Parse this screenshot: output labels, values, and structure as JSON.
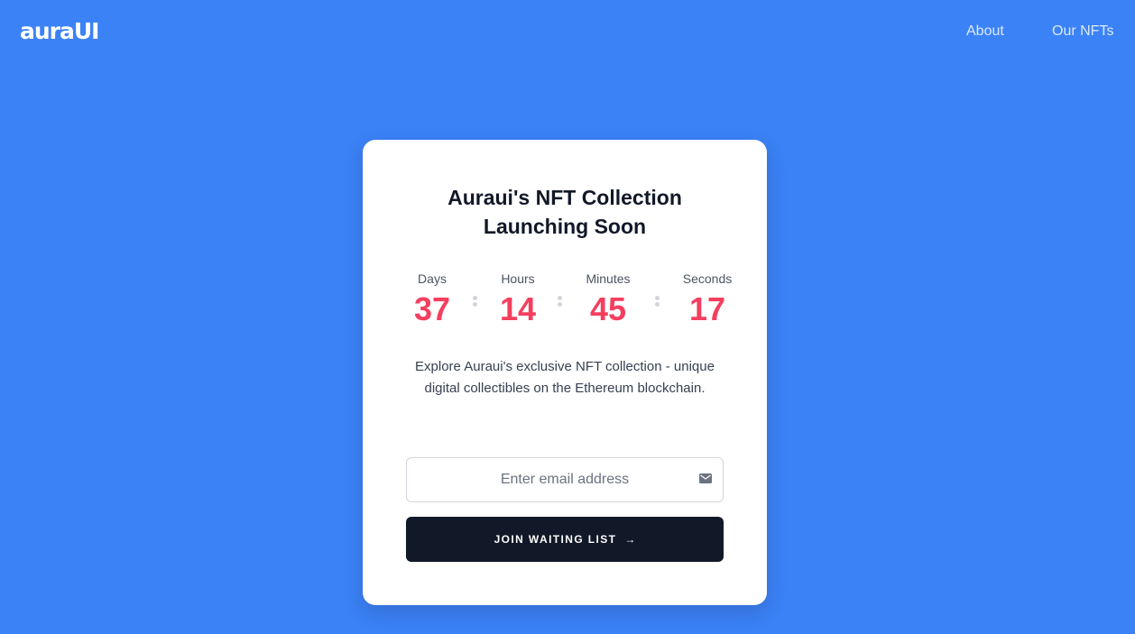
{
  "header": {
    "logo": "auraUI",
    "nav": [
      {
        "label": "About"
      },
      {
        "label": "Our NFTs"
      }
    ]
  },
  "card": {
    "title_line1": "Auraui's NFT Collection",
    "title_line2": "Launching Soon",
    "countdown": [
      {
        "label": "Days",
        "value": "37"
      },
      {
        "label": "Hours",
        "value": "14"
      },
      {
        "label": "Minutes",
        "value": "45"
      },
      {
        "label": "Seconds",
        "value": "17"
      }
    ],
    "description": "Explore Auraui's exclusive NFT collection - unique digital collectibles on the Ethereum blockchain.",
    "email": {
      "placeholder": "Enter email address",
      "value": "",
      "icon": "mail-icon"
    },
    "button": {
      "label": "JOIN WAITING LIST",
      "icon": "arrow-right-icon",
      "arrow": "→"
    }
  },
  "colors": {
    "background": "#3b82f6",
    "accent": "#f43f5e",
    "button": "#111827"
  }
}
